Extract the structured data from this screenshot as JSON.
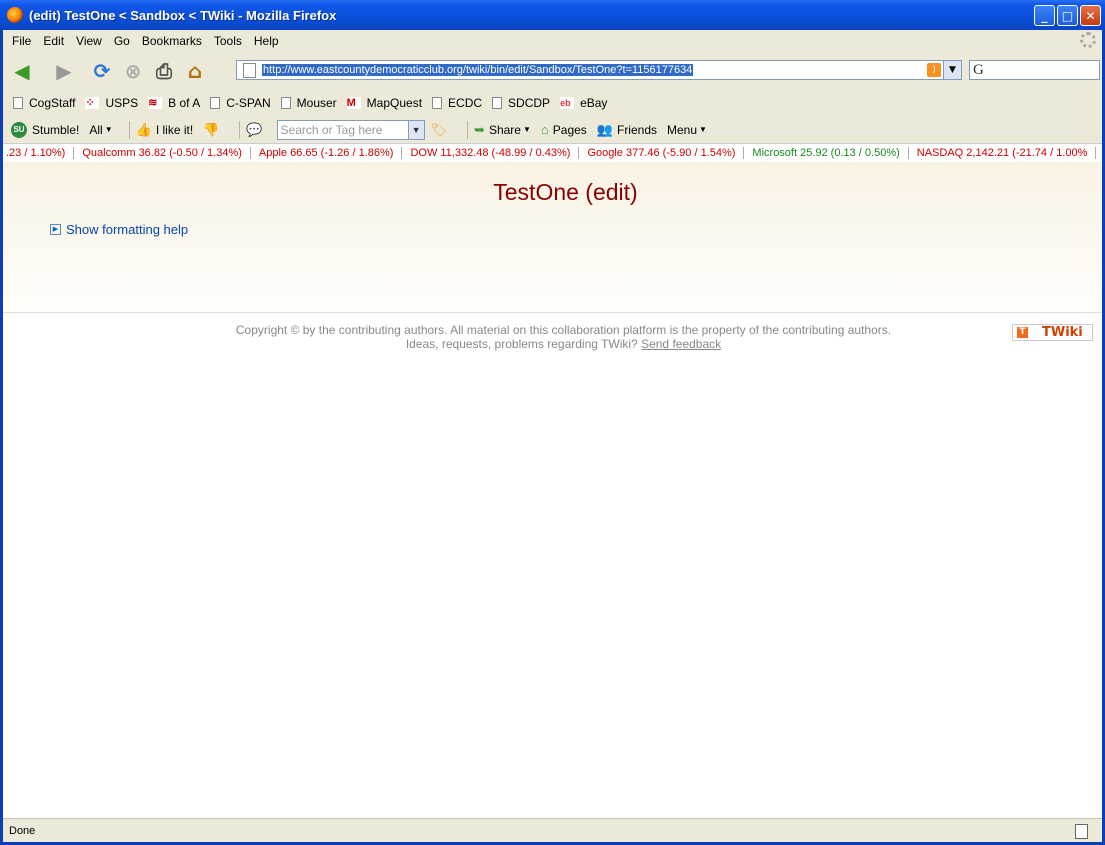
{
  "window": {
    "title": "(edit) TestOne < Sandbox < TWiki - Mozilla Firefox"
  },
  "menu": [
    "File",
    "Edit",
    "View",
    "Go",
    "Bookmarks",
    "Tools",
    "Help"
  ],
  "address": {
    "url": "http://www.eastcountydemocraticclub.org/twiki/bin/edit/Sandbox/TestOne?t=1156177634"
  },
  "bookmarks": [
    "CogStaff",
    "USPS",
    "B of A",
    "C-SPAN",
    "Mouser",
    "MapQuest",
    "ECDC",
    "SDCDP",
    "eBay"
  ],
  "stumble": {
    "stumble": "Stumble!",
    "all": "All",
    "like": "I like it!",
    "search_placeholder": "Search or Tag here",
    "share": "Share",
    "pages": "Pages",
    "friends": "Friends",
    "menu": "Menu"
  },
  "ticker": [
    {
      "text": ".23 / 1.10%)",
      "dir": "down"
    },
    {
      "text": "Qualcomm 36.82 (-0.50 / 1.34%)",
      "dir": "down"
    },
    {
      "text": "Apple 66.65 (-1.26 / 1.86%)",
      "dir": "down"
    },
    {
      "text": "DOW 11,332.48 (-48.99 / 0.43%)",
      "dir": "down"
    },
    {
      "text": "Google 377.46 (-5.90 / 1.54%)",
      "dir": "down"
    },
    {
      "text": "Microsoft 25.92 (0.13 / 0.50%)",
      "dir": "up"
    },
    {
      "text": "NASDAQ 2,142.21 (-21.74 / 1.00%",
      "dir": "down"
    }
  ],
  "page": {
    "title": "TestOne (edit)",
    "help_link": "Show formatting help"
  },
  "footer": {
    "line1": "Copyright © by the contributing authors. All material on this collaboration platform is the property of the contributing authors.",
    "line2_prefix": "Ideas, requests, problems regarding TWiki?",
    "feedback": "Send feedback",
    "logo": "TWiki"
  },
  "status": {
    "text": "Done"
  }
}
